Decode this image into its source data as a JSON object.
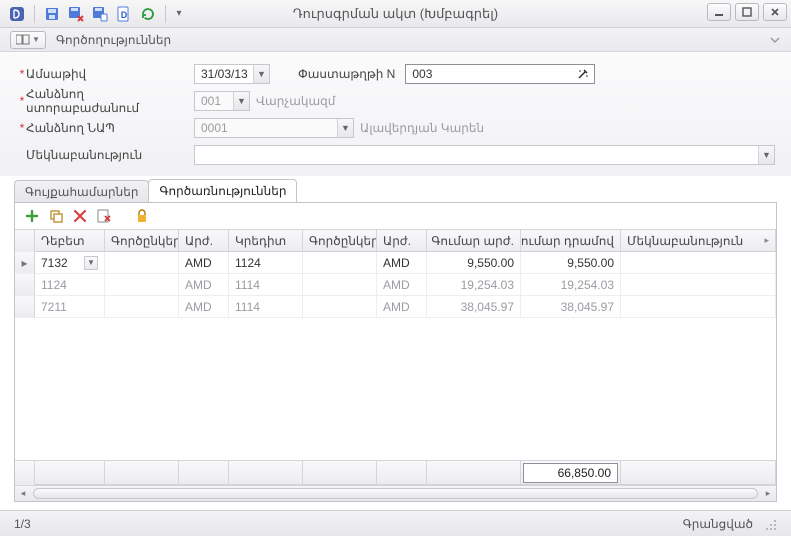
{
  "window": {
    "title": "Դուրսգրման ակտ (Խմբագրել)"
  },
  "secbar": {
    "label": "Գործողություններ"
  },
  "form": {
    "date": {
      "label": "Ամսաթիվ",
      "value": "31/03/13"
    },
    "docn": {
      "label": "Փաստաթղթի N",
      "value": "003"
    },
    "sub": {
      "label": "Հանձնող ստորաբաժանում",
      "value": "001",
      "aux": "Վարչակազմ"
    },
    "resp": {
      "label": "Հանձնող ՆԱՊ",
      "value": "0001",
      "aux": "Ալավերդյան Կարեն"
    },
    "comment": {
      "label": "Մեկնաբանություն",
      "value": ""
    }
  },
  "tabs": {
    "t1": "Գույքահամարներ",
    "t2": "Գործառնություններ"
  },
  "grid": {
    "headers": {
      "c1": "Դեբետ",
      "c2": "Գործընկեր",
      "c3": "Արժ.",
      "c4": "Կրեդիտ",
      "c5": "Գործընկեր",
      "c6": "Արժ.",
      "c7": "Գումար արժ.",
      "c8": "Գումար դրամով",
      "c9": "Մեկնաբանություն"
    },
    "rows": [
      {
        "debit": "7132",
        "p1": "",
        "cur1": "AMD",
        "credit": "1124",
        "p2": "",
        "cur2": "AMD",
        "amt": "9,550.00",
        "amd": "9,550.00",
        "note": ""
      },
      {
        "debit": "1124",
        "p1": "",
        "cur1": "AMD",
        "credit": "1114",
        "p2": "",
        "cur2": "AMD",
        "amt": "19,254.03",
        "amd": "19,254.03",
        "note": ""
      },
      {
        "debit": "7211",
        "p1": "",
        "cur1": "AMD",
        "credit": "1114",
        "p2": "",
        "cur2": "AMD",
        "amt": "38,045.97",
        "amd": "38,045.97",
        "note": ""
      }
    ],
    "total": "66,850.00"
  },
  "status": {
    "left": "1/3",
    "right": "Գրանցված"
  }
}
